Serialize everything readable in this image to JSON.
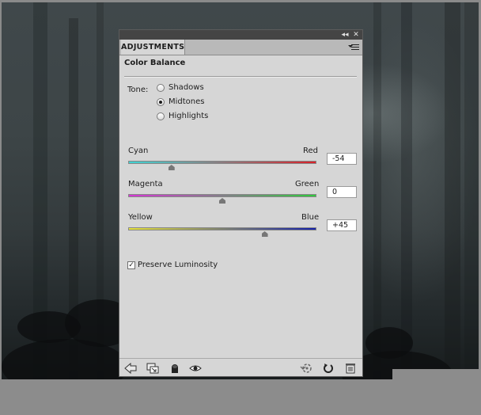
{
  "panel": {
    "tab_label": "ADJUSTMENTS",
    "collapse_glyph": "◂◂",
    "close_glyph": "✕",
    "title": "Color Balance"
  },
  "tone": {
    "label": "Tone:",
    "options": [
      {
        "label": "Shadows",
        "selected": false
      },
      {
        "label": "Midtones",
        "selected": true
      },
      {
        "label": "Highlights",
        "selected": false
      }
    ]
  },
  "sliders": [
    {
      "left_label": "Cyan",
      "right_label": "Red",
      "value": "-54",
      "numeric": -54,
      "left_color": "#3fd3d3",
      "right_color": "#d8222a"
    },
    {
      "left_label": "Magenta",
      "right_label": "Green",
      "value": "0",
      "numeric": 0,
      "left_color": "#d636d6",
      "right_color": "#30c83c"
    },
    {
      "left_label": "Yellow",
      "right_label": "Blue",
      "value": "+45",
      "numeric": 45,
      "left_color": "#e6e23a",
      "right_color": "#1420a8"
    }
  ],
  "preserve_luminosity": {
    "label": "Preserve Luminosity",
    "checked": true,
    "check_glyph": "✓"
  },
  "footer_icons": [
    "back-arrow-icon",
    "clip-to-layer-icon",
    "mask-icon",
    "visibility-eye-icon",
    "previous-state-icon",
    "reset-icon",
    "trash-icon"
  ]
}
